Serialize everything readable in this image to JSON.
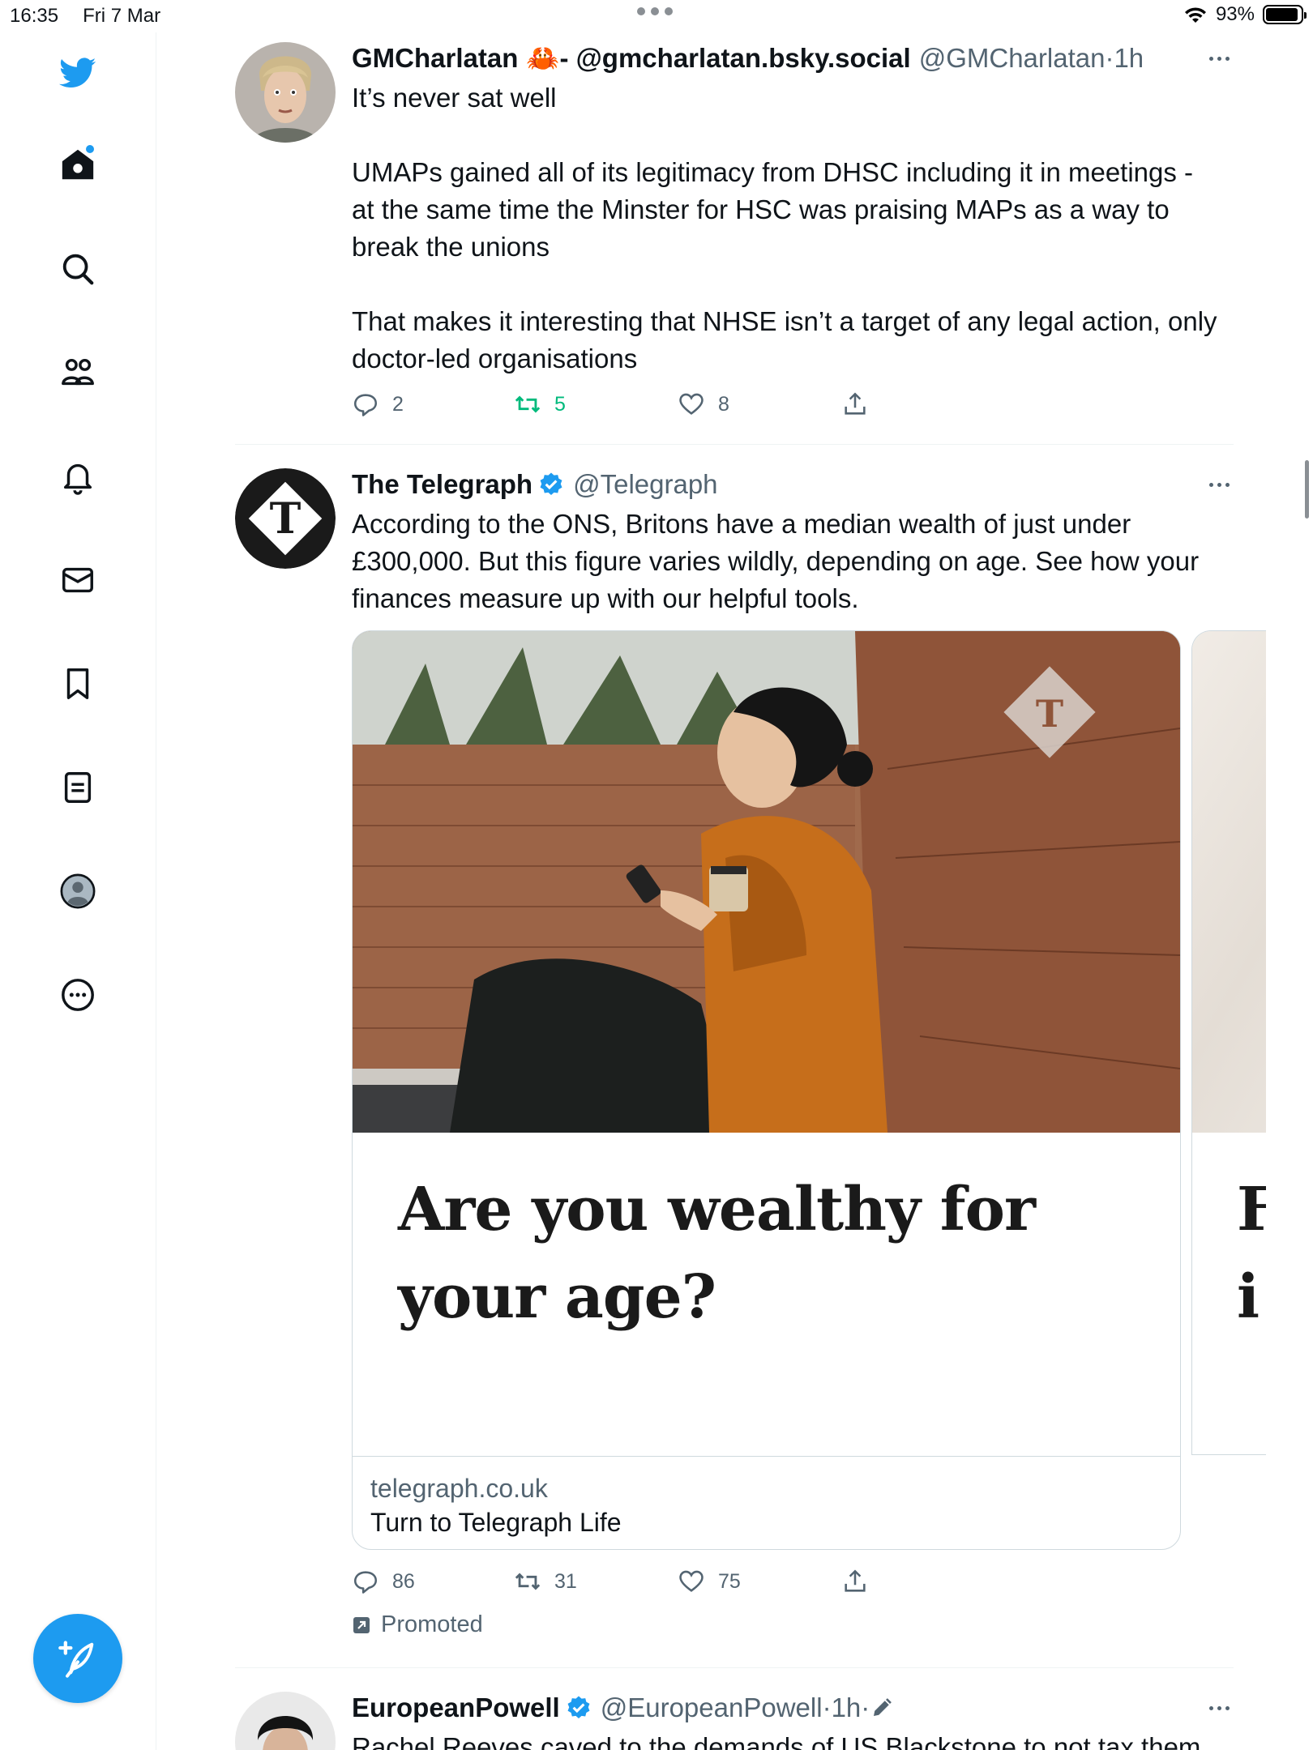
{
  "status_bar": {
    "time": "16:35",
    "date": "Fri 7 Mar",
    "battery": "93%",
    "battery_level": 0.93
  },
  "sidebar": {
    "items": [
      {
        "name": "twitter-logo",
        "icon": "bird-icon"
      },
      {
        "name": "home",
        "icon": "home-icon",
        "has_notification_dot": true
      },
      {
        "name": "explore",
        "icon": "search-icon"
      },
      {
        "name": "communities",
        "icon": "people-icon"
      },
      {
        "name": "notifications",
        "icon": "bell-icon"
      },
      {
        "name": "messages",
        "icon": "envelope-icon"
      },
      {
        "name": "bookmarks",
        "icon": "bookmark-icon"
      },
      {
        "name": "lists",
        "icon": "list-icon"
      },
      {
        "name": "profile",
        "icon": "avatar-icon"
      },
      {
        "name": "more",
        "icon": "more-circle-icon"
      }
    ],
    "compose_icon": "feather-plus-icon"
  },
  "colors": {
    "accent": "#1d9bf0",
    "retweet_active": "#00ba7c",
    "text_primary": "#0f1419",
    "text_secondary": "#536471"
  },
  "tweets": [
    {
      "name": "GMCharlatan",
      "name_suffix_emoji": "🦀",
      "name_suffix_text": " - @gmcharlatan.bsky.social",
      "handle": "@GMCharlatan",
      "separator": " · ",
      "time": "1h",
      "text": "It’s never sat well\n\nUMAPs gained all of its legitimacy from DHSC including it in meetings - at the same time the Minster for HSC was praising MAPs as a way to break the unions\n\nThat makes it interesting that NHSE isn’t a target of any legal action, only doctor-led organisations",
      "replies": "2",
      "retweets": "5",
      "retweeted": true,
      "likes": "8"
    },
    {
      "name": "The Telegraph",
      "verified": true,
      "handle": "@Telegraph",
      "text": "According to the ONS, Britons have a median wealth of just under £300,000. But this figure varies wildly, depending on age. See how your finances measure up with our helpful tools.",
      "card": {
        "headline_line1": "Are you wealthy for",
        "headline_line2": "your age?",
        "domain": "telegraph.co.uk",
        "subtitle": "Turn to Telegraph Life",
        "next_card_line1": "F",
        "next_card_line2": "i"
      },
      "replies": "86",
      "retweets": "31",
      "likes": "75",
      "promoted_label": "Promoted"
    },
    {
      "name": "EuropeanPowell",
      "verified": true,
      "handle": "@EuropeanPowell",
      "separator": " · ",
      "time": "1h",
      "time_suffix": " · ",
      "edited_icon": "pencil-icon",
      "text": "Rachel Reeves caved to the demands of US Blackstone to not tax them"
    }
  ]
}
